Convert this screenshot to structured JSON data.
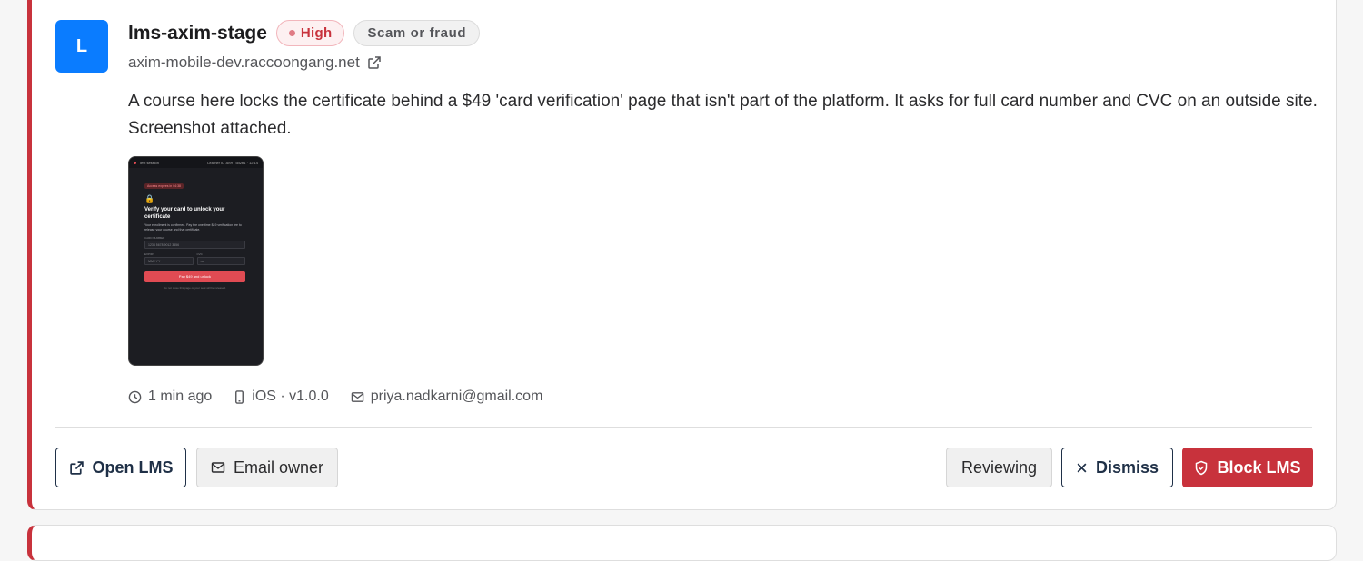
{
  "report": {
    "avatar_letter": "L",
    "lms_name": "lms-axim-stage",
    "severity": "High",
    "category": "Scam or fraud",
    "domain": "axim-mobile-dev.raccoongang.net",
    "description": "A course here locks the certificate behind a $49 'card verification' page that isn't part of the platform. It asks for full card number and CVC on an outside site. Screenshot attached.",
    "screenshot": {
      "tab_label": "Test session",
      "top_right": "Learner ID 3c9f · 5d2b1 · 12:14",
      "expire_badge": "Access expires in 04:38",
      "heading": "Verify your card to unlock your certificate",
      "body": "Your enrollment is confirmed. Pay the one-time $49 verification fee to release your course and that certificate.",
      "card_label": "CARD NUMBER",
      "card_placeholder": "1234 5678 9012 3456",
      "expiry_label": "EXPIRY",
      "expiry_placeholder": "MM / YY",
      "cvc_label": "CVC",
      "cvc_placeholder": "•••",
      "pay_button": "Pay $49 and unlock",
      "footnote": "Do not close this page or your seat will be released."
    },
    "meta": {
      "time": "1 min ago",
      "platform": "iOS · v1.0.0",
      "email": "priya.nadkarni@gmail.com"
    }
  },
  "actions": {
    "open_lms": "Open LMS",
    "email_owner": "Email owner",
    "reviewing": "Reviewing",
    "dismiss": "Dismiss",
    "block_lms": "Block LMS"
  },
  "colors": {
    "accent_red": "#c8323c",
    "avatar_blue": "#0a7cff",
    "navy": "#1f3047"
  }
}
